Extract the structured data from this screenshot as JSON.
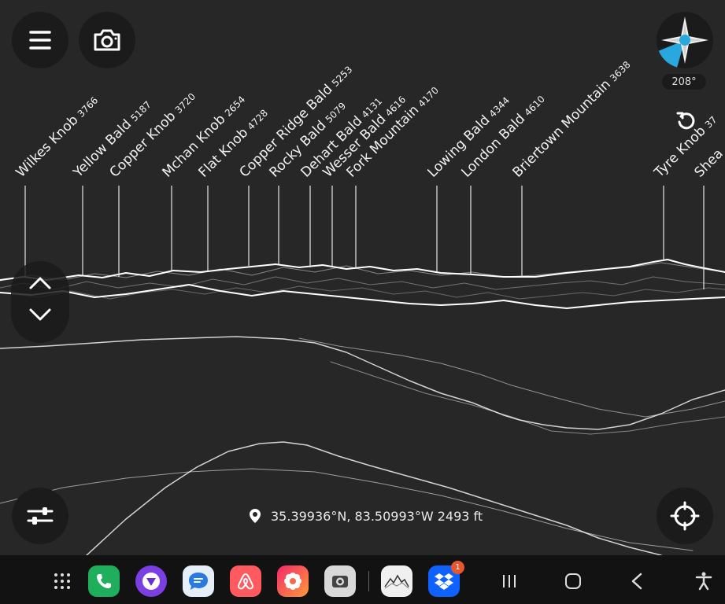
{
  "peaks": [
    {
      "name": "Wilkes Knob",
      "elev": "3766"
    },
    {
      "name": "Yellow Bald",
      "elev": "5187"
    },
    {
      "name": "Copper Knob",
      "elev": "3720"
    },
    {
      "name": "Mchan Knob",
      "elev": "2654"
    },
    {
      "name": "Flat Knob",
      "elev": "4728"
    },
    {
      "name": "Copper Ridge Bald",
      "elev": "5253"
    },
    {
      "name": "Rocky Bald",
      "elev": "5079"
    },
    {
      "name": "Dehart Bald",
      "elev": "4131"
    },
    {
      "name": "Wesser Bald",
      "elev": "4616"
    },
    {
      "name": "Fork Mountain",
      "elev": "4170"
    },
    {
      "name": "Lowing Bald",
      "elev": "4344"
    },
    {
      "name": "London Bald",
      "elev": "4610"
    },
    {
      "name": "Briertown Mountain",
      "elev": "3638"
    },
    {
      "name": "Tyre Knob",
      "elev": "37"
    },
    {
      "name": "Shea",
      "elev": ""
    }
  ],
  "compass": {
    "heading": "208°"
  },
  "location": {
    "coords": "35.39936°N, 83.50993°W 2493 ft"
  },
  "taskbar": {
    "dropbox_badge": "1"
  },
  "colors": {
    "background": "#272727",
    "ridge": "#ffffff",
    "taskbar": "#121212",
    "accent": "#29a8e0"
  }
}
